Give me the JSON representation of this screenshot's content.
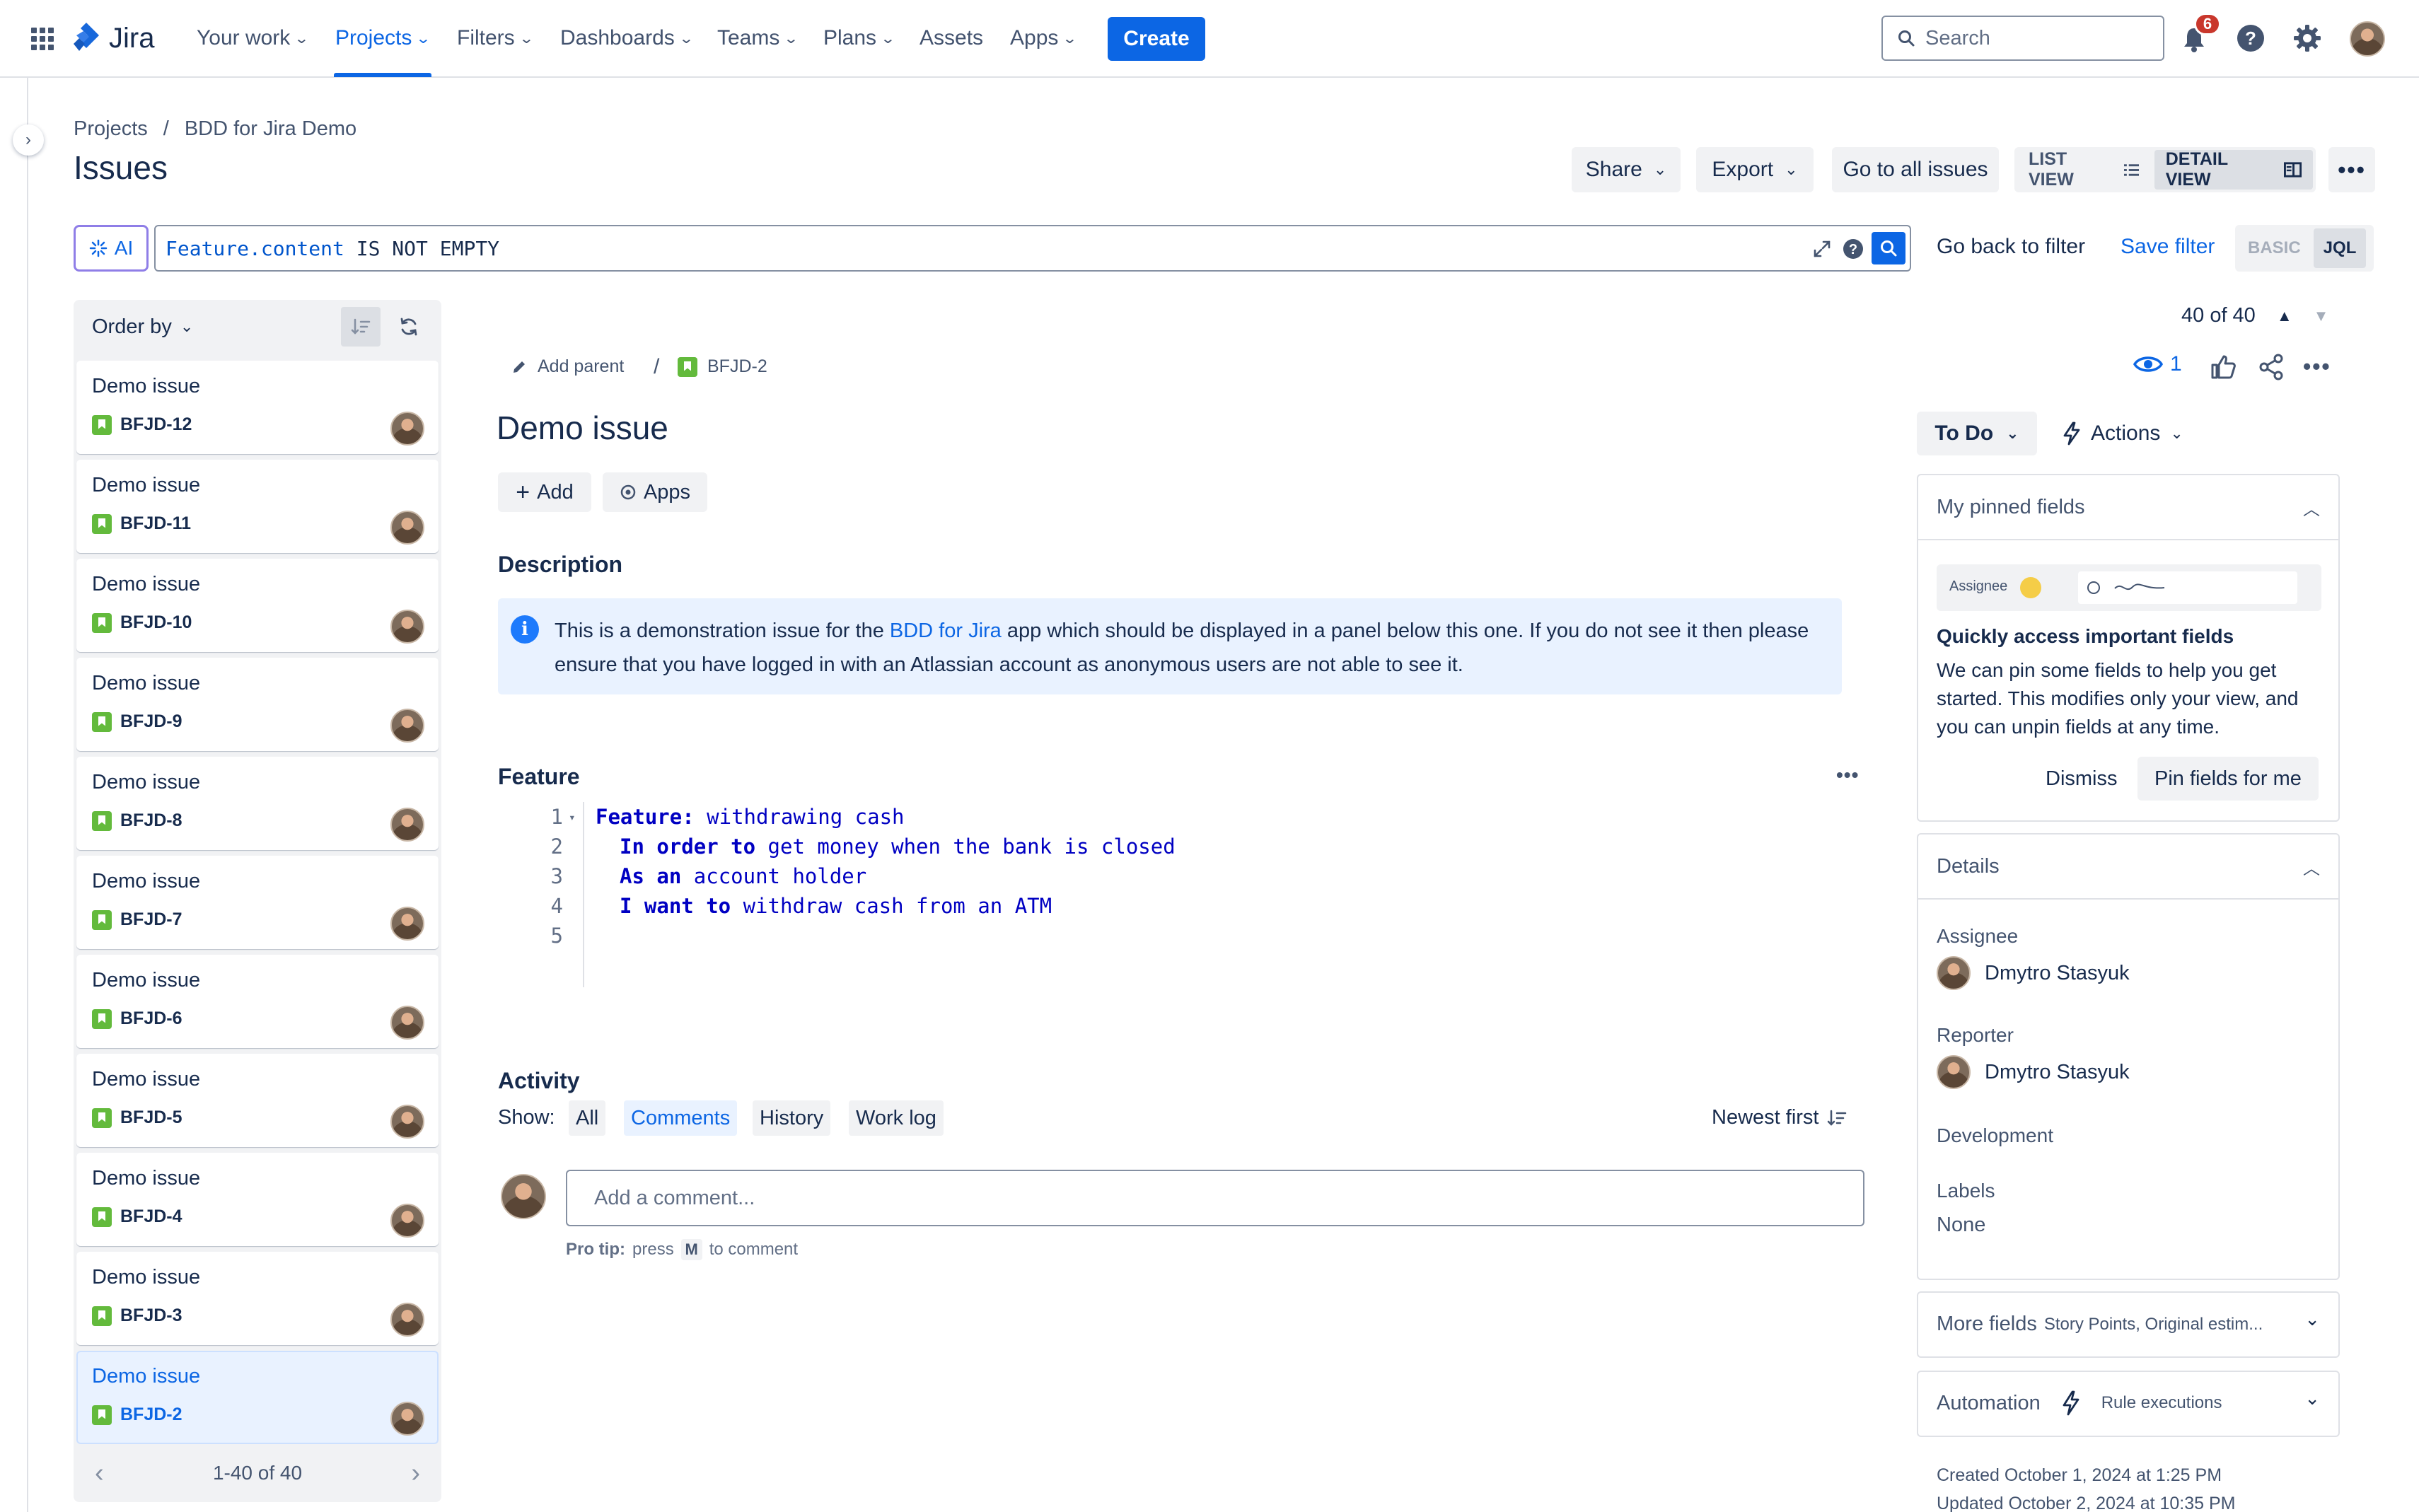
{
  "nav": {
    "product": "Jira",
    "items": [
      {
        "label": "Your work",
        "chev": true
      },
      {
        "label": "Projects",
        "chev": true,
        "active": true
      },
      {
        "label": "Filters",
        "chev": true
      },
      {
        "label": "Dashboards",
        "chev": true
      },
      {
        "label": "Teams",
        "chev": true
      },
      {
        "label": "Plans",
        "chev": true
      },
      {
        "label": "Assets",
        "chev": false
      },
      {
        "label": "Apps",
        "chev": true
      }
    ],
    "create_label": "Create",
    "search_placeholder": "Search",
    "notifications_count": "6"
  },
  "breadcrumb": {
    "root": "Projects",
    "separator": "/",
    "project": "BDD for Jira Demo"
  },
  "page_title": "Issues",
  "header_actions": {
    "share": "Share",
    "export": "Export",
    "go_to_all": "Go to all issues",
    "list_view": "LIST VIEW",
    "detail_view": "DETAIL VIEW"
  },
  "jql": {
    "ai_label": "AI",
    "query_field": "Feature.content",
    "query_op": "IS NOT",
    "query_value": "EMPTY",
    "go_back": "Go back to filter",
    "save_filter": "Save filter",
    "basic": "BASIC",
    "jql_label": "JQL"
  },
  "issue_list": {
    "order_by": "Order by",
    "items": [
      {
        "title": "Demo issue",
        "key": "BFJD-12"
      },
      {
        "title": "Demo issue",
        "key": "BFJD-11"
      },
      {
        "title": "Demo issue",
        "key": "BFJD-10"
      },
      {
        "title": "Demo issue",
        "key": "BFJD-9"
      },
      {
        "title": "Demo issue",
        "key": "BFJD-8"
      },
      {
        "title": "Demo issue",
        "key": "BFJD-7"
      },
      {
        "title": "Demo issue",
        "key": "BFJD-6"
      },
      {
        "title": "Demo issue",
        "key": "BFJD-5"
      },
      {
        "title": "Demo issue",
        "key": "BFJD-4"
      },
      {
        "title": "Demo issue",
        "key": "BFJD-3"
      },
      {
        "title": "Demo issue",
        "key": "BFJD-2",
        "selected": true
      }
    ],
    "pagination": "1-40 of 40"
  },
  "issue": {
    "position": "40 of 40",
    "add_parent": "Add parent",
    "key": "BFJD-2",
    "watchers": "1",
    "title": "Demo issue",
    "add_label": "Add",
    "apps_label": "Apps",
    "description_heading": "Description",
    "description_before": "This is a demonstration issue for the ",
    "description_link": "BDD for Jira",
    "description_after": " app which should be displayed in a panel below this one. If you do not see it then please ensure that you have logged in with an Atlassian account as anonymous users are not able to see it.",
    "feature_heading": "Feature",
    "feature_lines": [
      {
        "num": "1",
        "kw": "Feature:",
        "text": " withdrawing cash",
        "indent": false
      },
      {
        "num": "2",
        "kw": "In order to",
        "text": " get money when the bank is closed",
        "indent": true
      },
      {
        "num": "3",
        "kw": "As an",
        "text": " account holder",
        "indent": true
      },
      {
        "num": "4",
        "kw": "I want to",
        "text": " withdraw cash from an ATM",
        "indent": true
      },
      {
        "num": "5",
        "kw": "",
        "text": "",
        "indent": false
      }
    ],
    "activity_heading": "Activity",
    "show_label": "Show:",
    "activity_tabs": [
      "All",
      "Comments",
      "History",
      "Work log"
    ],
    "activity_active": "Comments",
    "sort_label": "Newest first",
    "comment_placeholder": "Add a comment...",
    "pro_tip_prefix": "Pro tip:",
    "pro_tip_press": "press",
    "pro_tip_key": "M",
    "pro_tip_suffix": "to comment"
  },
  "sidebar": {
    "status": "To Do",
    "actions": "Actions",
    "pinned": {
      "heading": "My pinned fields",
      "preview_label": "Assignee",
      "title": "Quickly access important fields",
      "body": "We can pin some fields to help you get started. This modifies only your view, and you can unpin fields at any time.",
      "dismiss": "Dismiss",
      "pin": "Pin fields for me"
    },
    "details": {
      "heading": "Details",
      "assignee_label": "Assignee",
      "assignee": "Dmytro Stasyuk",
      "reporter_label": "Reporter",
      "reporter": "Dmytro Stasyuk",
      "development_label": "Development",
      "labels_label": "Labels",
      "labels_value": "None"
    },
    "more_fields": {
      "label": "More fields",
      "hint": "Story Points, Original estim..."
    },
    "automation": {
      "label": "Automation",
      "hint": "Rule executions"
    },
    "created": "Created October 1, 2024 at 1:25 PM",
    "updated": "Updated October 2, 2024 at 10:35 PM"
  },
  "colors": {
    "brand": "#0c66e4",
    "story": "#63ba3c",
    "badge": "#c9372c"
  }
}
